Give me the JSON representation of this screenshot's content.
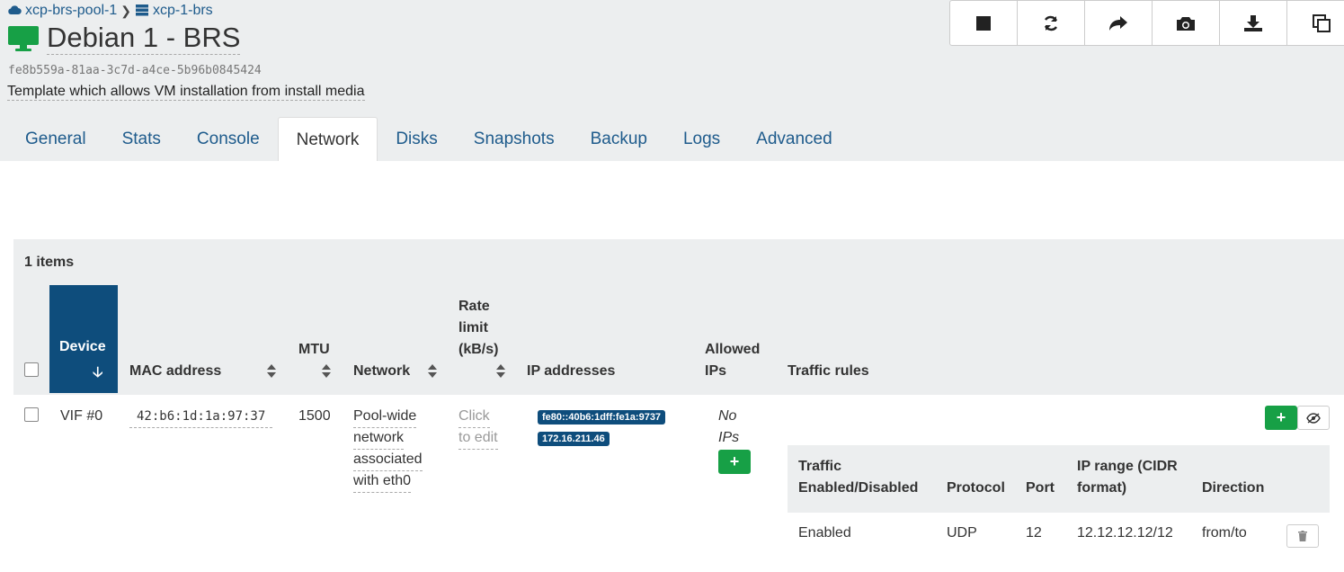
{
  "breadcrumb": {
    "pool": "xcp-brs-pool-1",
    "host": "xcp-1-brs"
  },
  "vm": {
    "title": "Debian 1 - BRS",
    "uuid": "fe8b559a-81aa-3c7d-a4ce-5b96b0845424",
    "description": "Template which allows VM installation from install media"
  },
  "actions": [
    "stop-icon",
    "restart-icon",
    "migrate-icon",
    "snapshot-icon",
    "export-icon",
    "copy-icon"
  ],
  "tabs": [
    "General",
    "Stats",
    "Console",
    "Network",
    "Disks",
    "Snapshots",
    "Backup",
    "Logs",
    "Advanced"
  ],
  "active_tab": "Network",
  "table": {
    "count": "1 items",
    "headers": {
      "device": "Device",
      "mac": "MAC address",
      "mtu": "MTU",
      "network": "Network",
      "rate_1": "Rate",
      "rate_2": "limit",
      "rate_3": "(kB/s)",
      "ips": "IP addresses",
      "allowed_1": "Allowed",
      "allowed_2": "IPs",
      "traffic": "Traffic rules"
    },
    "rows": [
      {
        "device": "VIF #0",
        "mac": "42:b6:1d:1a:97:37",
        "mtu": "1500",
        "network": [
          "Pool-wide",
          "network",
          "associated",
          "with eth0"
        ],
        "rate": [
          "Click",
          "to edit"
        ],
        "ips": [
          "fe80::40b6:1dff:fe1a:9737",
          "172.16.211.46"
        ],
        "allowed": [
          "No",
          "IPs"
        ]
      }
    ]
  },
  "traffic_rules": {
    "headers": {
      "traffic_1": "Traffic",
      "traffic_2": "Enabled/Disabled",
      "protocol": "Protocol",
      "port": "Port",
      "range_1": "IP range (CIDR",
      "range_2": "format)",
      "direction": "Direction"
    },
    "rows": [
      {
        "status": "Enabled",
        "protocol": "UDP",
        "port": "12",
        "range": "12.12.12.12/12",
        "direction": "from/to"
      }
    ]
  },
  "colors": {
    "accent": "#0e4d7c",
    "link": "#1e5b8c",
    "success": "#17a046",
    "header_bg": "#eceeef"
  }
}
